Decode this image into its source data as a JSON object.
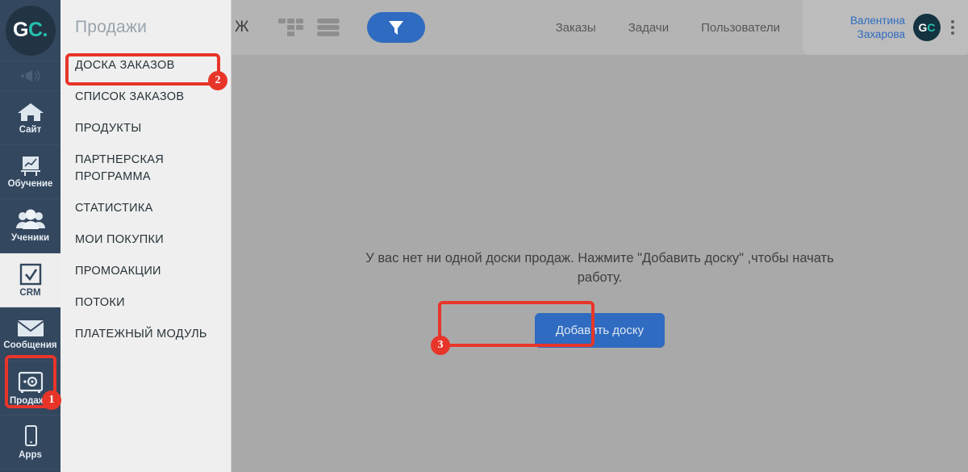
{
  "brand": {
    "logo_primary": "G",
    "logo_secondary": "C.",
    "logo_color_primary": "#ffffff",
    "logo_color_secondary": "#24c0ad"
  },
  "rail": {
    "items": [
      {
        "label": "Сайт",
        "icon": "home-icon"
      },
      {
        "label": "Обучение",
        "icon": "presentation-chart-icon"
      },
      {
        "label": "Ученики",
        "icon": "users-icon"
      },
      {
        "label": "CRM",
        "icon": "checkbox-check-icon"
      },
      {
        "label": "Сообщения",
        "icon": "envelope-icon"
      },
      {
        "label": "Продажи",
        "icon": "safe-box-icon"
      },
      {
        "label": "Apps",
        "icon": "mobile-phone-icon"
      }
    ],
    "megaphone_icon": "megaphone-icon"
  },
  "flyout": {
    "title": "Продажи",
    "items": [
      "ДОСКА ЗАКАЗОВ",
      "СПИСОК ЗАКАЗОВ",
      "ПРОДУКТЫ",
      "ПАРТНЕРСКАЯ ПРОГРАММА",
      "СТАТИСТИКА",
      "МОИ ПОКУПКИ",
      "ПРОМОАКЦИИ",
      "ПОТОКИ",
      "ПЛАТЕЖНЫЙ МОДУЛЬ"
    ]
  },
  "header": {
    "breadcrumb_fragment": "Ж",
    "kanban_icon": "kanban-board-icon",
    "list_icon": "list-view-icon",
    "filter_icon": "funnel-filter-icon",
    "nav": [
      "Заказы",
      "Задачи",
      "Пользователи"
    ],
    "user": {
      "first_name": "Валентина",
      "last_name": "Захарова",
      "avatar_initials_primary": "G",
      "avatar_initials_secondary": "C",
      "menu_icon": "kebab-menu-icon"
    }
  },
  "main": {
    "empty_message": "У вас нет ни одной доски продаж. Нажмите \"Добавить доску\" ,чтобы начать работу.",
    "add_board_label": "Добавить доску"
  },
  "annotations": {
    "badges": [
      {
        "number": "1",
        "target": "rail-item-prodazhi"
      },
      {
        "number": "2",
        "target": "flyout-item-doska-zakazov"
      },
      {
        "number": "3",
        "target": "add-board-button"
      }
    ],
    "highlight_color": "#e8352a"
  },
  "colors": {
    "rail_bg": "#33475e",
    "flyout_bg": "#efefef",
    "header_bg": "#b4b4b4",
    "content_bg": "#a9a9a9",
    "accent_blue": "#2f6bc0",
    "badge_red": "#e8352a"
  }
}
